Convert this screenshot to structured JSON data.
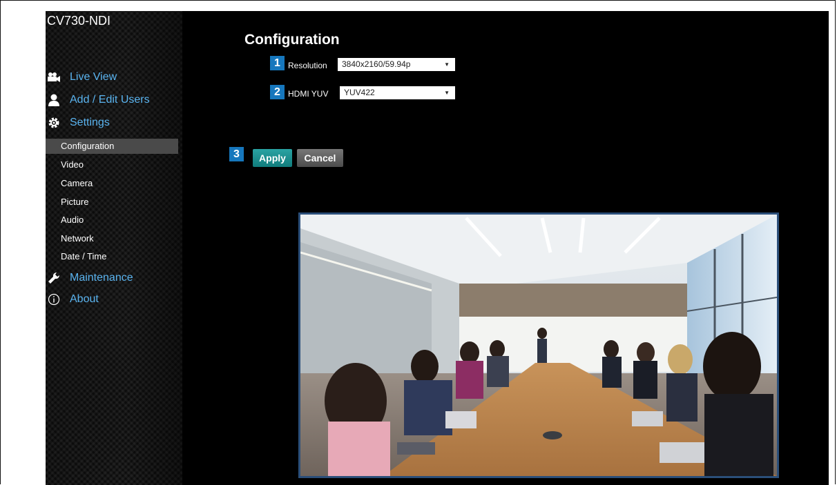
{
  "app": {
    "device_name": "CV730-NDI"
  },
  "nav": {
    "main": [
      {
        "label": "Live View",
        "icon": "video-camera-icon"
      },
      {
        "label": "Add / Edit Users",
        "icon": "user-icon"
      },
      {
        "label": "Settings",
        "icon": "gear-icon"
      }
    ],
    "settings_items": [
      "Configuration",
      "Video",
      "Camera",
      "Picture",
      "Audio",
      "Network",
      "Date / Time"
    ],
    "active_item": "Configuration",
    "bottom": [
      {
        "label": "Maintenance",
        "icon": "wrench-icon"
      },
      {
        "label": "About",
        "icon": "info-icon"
      }
    ]
  },
  "page": {
    "title": "Configuration",
    "resolution": {
      "badge": "1",
      "label": "Resolution",
      "value": "3840x2160/59.94p"
    },
    "hdmi_yuv": {
      "badge": "2",
      "label": "HDMI YUV",
      "value": "YUV422"
    },
    "actions": {
      "badge": "3",
      "apply": "Apply",
      "cancel": "Cancel"
    }
  },
  "colors": {
    "accent_link": "#5ab4f0",
    "badge": "#1677bd",
    "apply": "#1a8f8f",
    "preview_border": "#2b4f7a"
  }
}
